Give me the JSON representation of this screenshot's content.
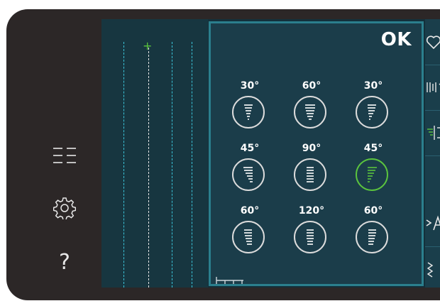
{
  "dialog": {
    "ok_label": "OK",
    "tiles": [
      {
        "angle": "30°",
        "selected": false
      },
      {
        "angle": "60°",
        "selected": false
      },
      {
        "angle": "30°",
        "selected": false
      },
      {
        "angle": "45°",
        "selected": false
      },
      {
        "angle": "90°",
        "selected": false
      },
      {
        "angle": "45°",
        "selected": true
      },
      {
        "angle": "60°",
        "selected": false
      },
      {
        "angle": "120°",
        "selected": false
      },
      {
        "angle": "60°",
        "selected": false
      }
    ]
  },
  "left_icons": [
    "menu-list-icon",
    "settings-gear-icon",
    "help-question-icon"
  ],
  "help_glyph": "?",
  "colors": {
    "accent_green": "#5bc43e",
    "guide_cyan": "#3bc3d8",
    "dialog_border": "#2b7f8d"
  }
}
